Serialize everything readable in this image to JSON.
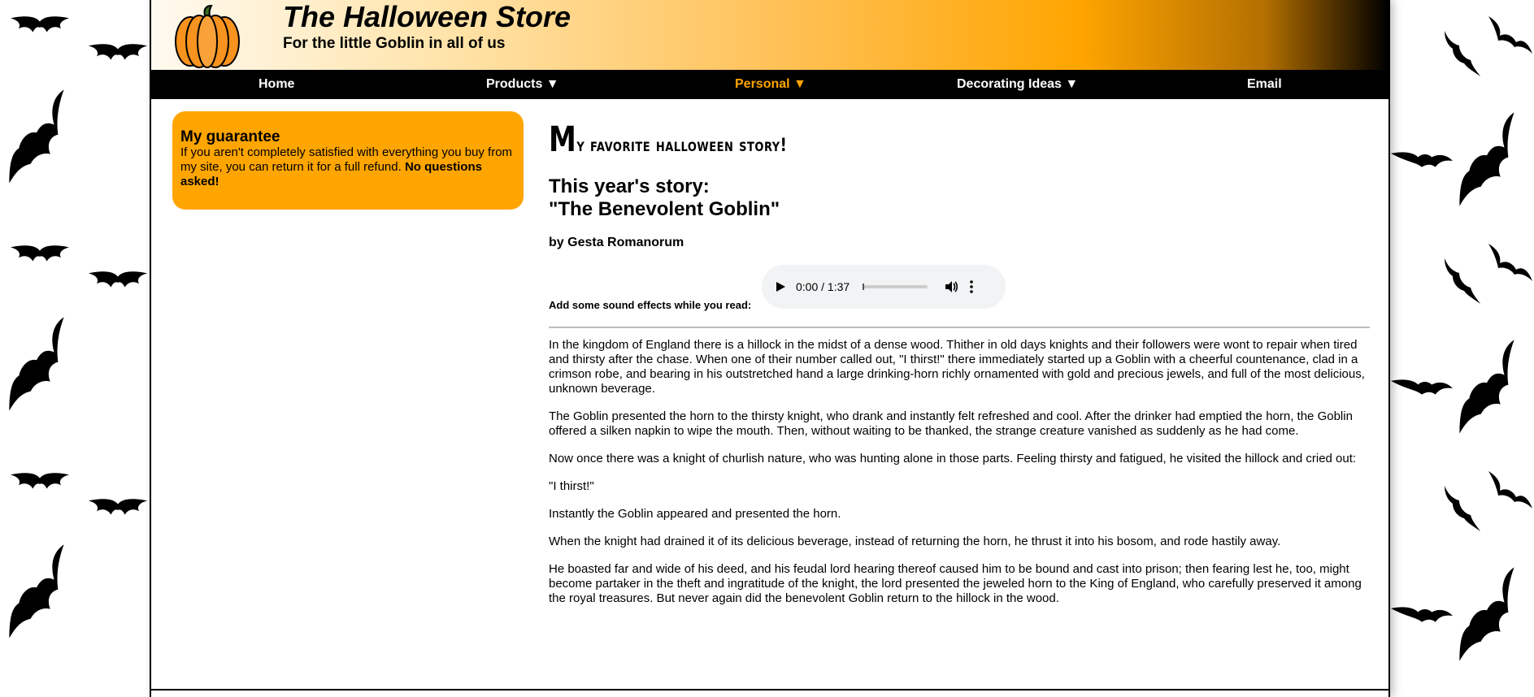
{
  "site": {
    "title": "The Halloween Store",
    "tagline": "For the little Goblin in all of us"
  },
  "nav": {
    "items": [
      {
        "label": "Home",
        "icon": "",
        "active": false
      },
      {
        "label": "Products ▼",
        "active": false
      },
      {
        "label": "Personal ▼",
        "active": true
      },
      {
        "label": "Decorating Ideas ▼",
        "active": false
      },
      {
        "label": "Email",
        "active": false
      }
    ]
  },
  "guarantee": {
    "heading": "My guarantee",
    "text": "If you aren't completely satisfied with everything you buy from my site, you can return it for a full refund. ",
    "emphasis": "No questions asked!"
  },
  "story": {
    "heading_first": "M",
    "heading_rest": "y favorite halloween story!",
    "title_line1": "This year's story:",
    "title_line2": "\"The Benevolent Goblin\"",
    "byline": "by Gesta Romanorum",
    "sound_label": "Add some sound effects while you read:",
    "audio_time": "0:00 / 1:37",
    "paragraphs": [
      "In the kingdom of England there is a hillock in the midst of a dense wood. Thither in old days knights and their followers were wont to repair when tired and thirsty after the chase. When one of their number called out, \"I thirst!\" there immediately started up a Goblin with a cheerful countenance, clad in a crimson robe, and bearing in his outstretched hand a large drinking-horn richly ornamented with gold and precious jewels, and full of the most delicious, unknown beverage.",
      "The Goblin presented the horn to the thirsty knight, who drank and instantly felt refreshed and cool. After the drinker had emptied the horn, the Goblin offered a silken napkin to wipe the mouth. Then, without waiting to be thanked, the strange creature vanished as suddenly as he had come.",
      "Now once there was a knight of churlish nature, who was hunting alone in those parts. Feeling thirsty and fatigued, he visited the hillock and cried out:",
      "\"I thirst!\"",
      "Instantly the Goblin appeared and presented the horn.",
      "When the knight had drained it of its delicious beverage, instead of returning the horn, he thrust it into his bosom, and rode hastily away.",
      "He boasted far and wide of his deed, and his feudal lord hearing thereof caused him to be bound and cast into prison; then fearing lest he, too, might become partaker in the theft and ingratitude of the knight, the lord presented the jeweled horn to the King of England, who carefully preserved it among the royal treasures. But never again did the benevolent Goblin return to the hillock in the wood."
    ]
  },
  "colors": {
    "accent": "#ffa500",
    "nav_bg": "#000000",
    "background": "#ffffff"
  },
  "icons": {
    "logo": "pumpkin-icon",
    "wallpaper": "bat-icon"
  }
}
